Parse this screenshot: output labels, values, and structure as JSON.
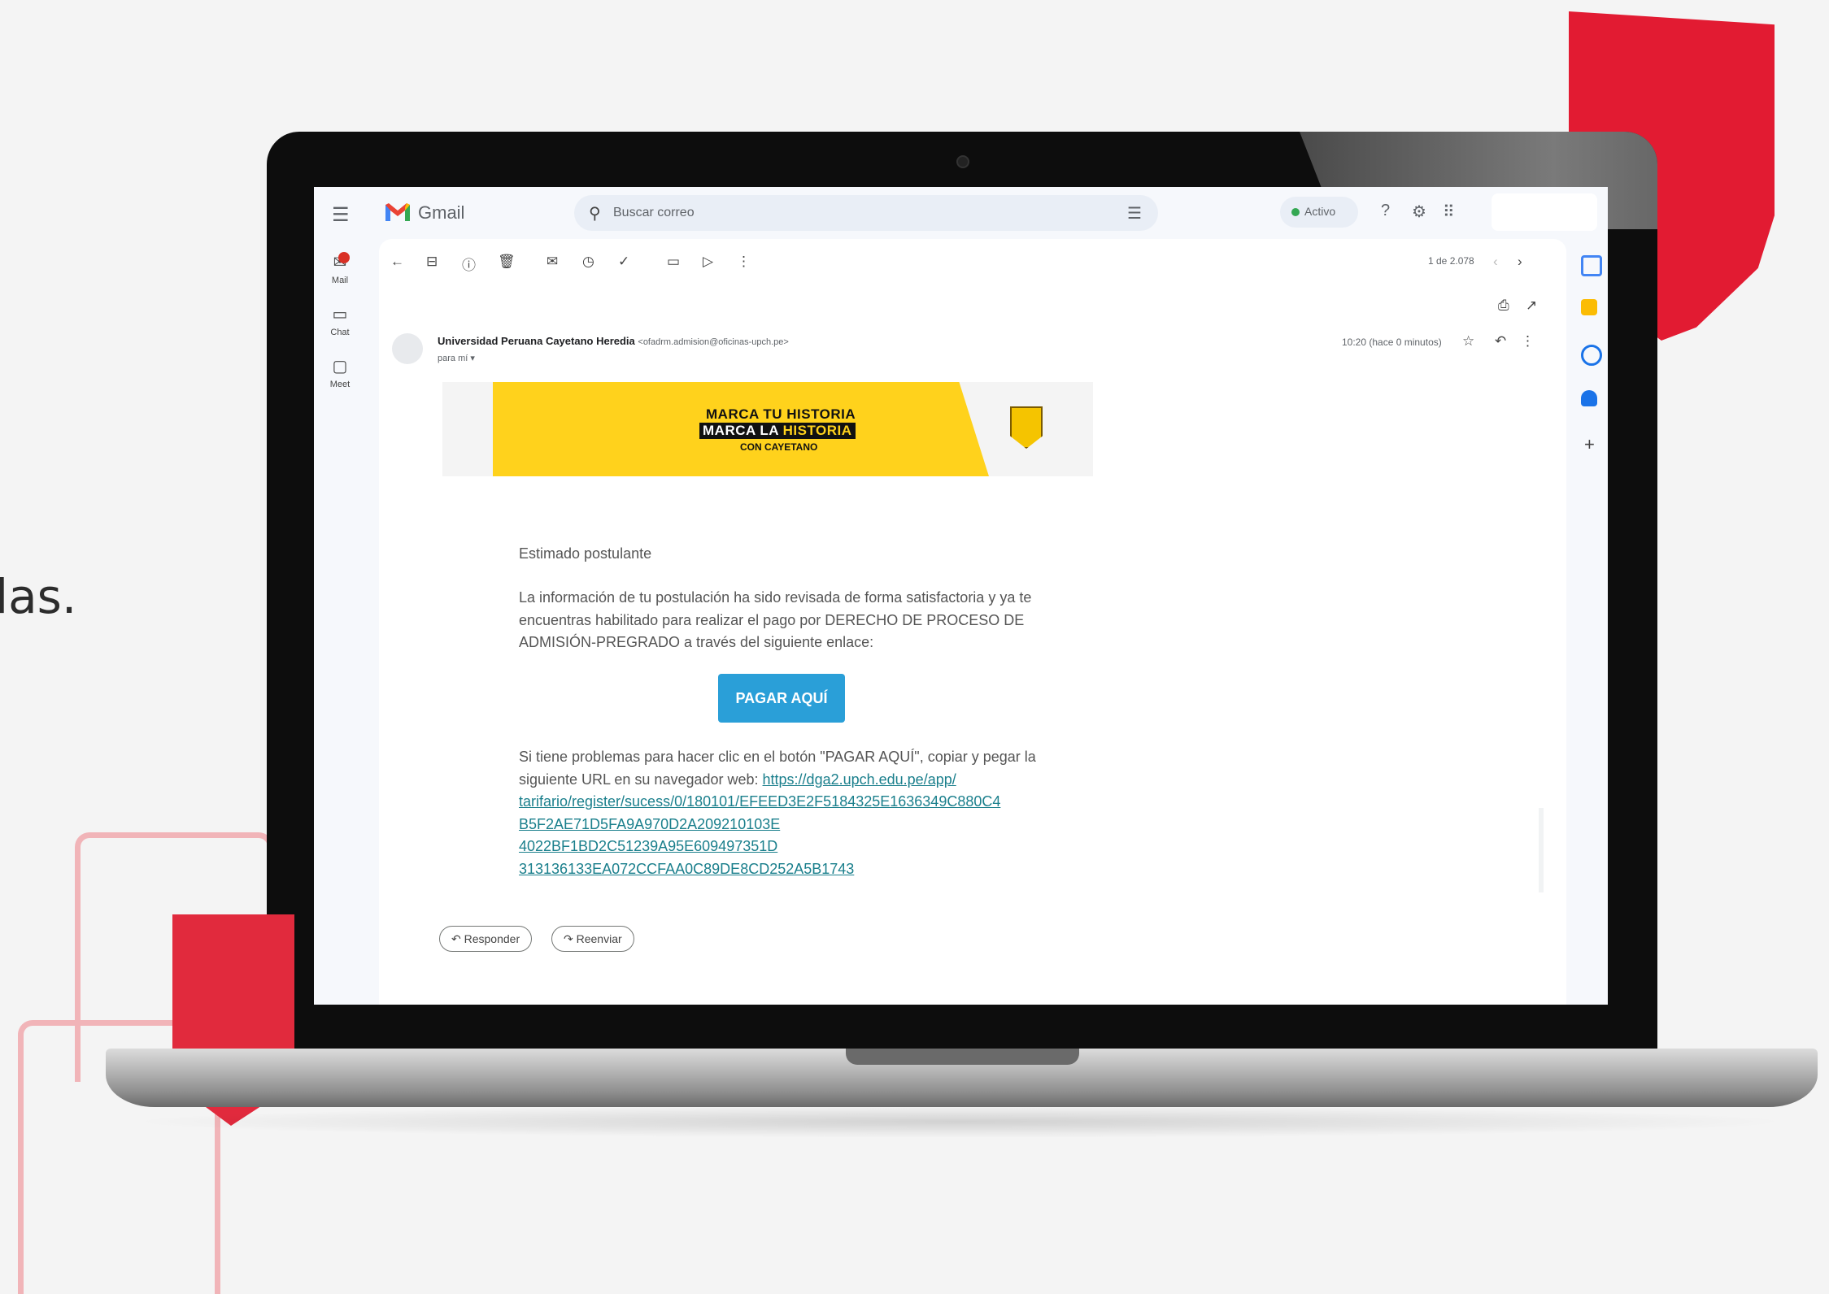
{
  "decor": {
    "side_text": "las."
  },
  "gmail": {
    "app_title": "Gmail",
    "search_placeholder": "Buscar correo",
    "status": "Activo",
    "rail": [
      {
        "label": "Mail",
        "icon": "mail-icon"
      },
      {
        "label": "Chat",
        "icon": "chat-icon"
      },
      {
        "label": "Meet",
        "icon": "meet-icon"
      }
    ],
    "pager": "1 de 2.078"
  },
  "email": {
    "sender_name": "Universidad Peruana Cayetano Heredia",
    "sender_email": "<ofadrm.admision@oficinas-upch.pe>",
    "recipient": "para mí",
    "time": "10:20 (hace 0 minutos)",
    "banner": {
      "line1": "MARCA TU HISTORIA",
      "line2_a": "MARCA LA ",
      "line2_b": "HISTORIA",
      "line3": "CON CAYETANO"
    },
    "greeting": "Estimado postulante",
    "paragraph1": "La información de tu postulación ha sido revisada de forma satisfactoria y ya te encuentras habilitado para realizar el pago por DERECHO DE PROCESO DE ADMISIÓN-PREGRADO a través del siguiente enlace:",
    "pay_button": "PAGAR AQUÍ",
    "paragraph2": "Si tiene problemas para hacer clic en el botón \"PAGAR AQUÍ\", copiar y pegar la siguiente URL en su navegador web: ",
    "link_lines": [
      "https://dga2.upch.edu.pe/app/",
      "tarifario/register/sucess/0/180101/EFEED3E2F5184325E1636349C880C4",
      "B5F2AE71D5FA9A970D2A209210103E",
      "4022BF1BD2C51239A95E609497351D",
      "313136133EA072CCFAA0C89DE8CD252A5B1743"
    ],
    "reply_button": "Responder",
    "forward_button": "Reenviar"
  },
  "colors": {
    "accent": "#e21b32",
    "banner_yellow": "#ffd21c",
    "pay_button": "#2a9fd8",
    "link": "#1a7f8c"
  }
}
